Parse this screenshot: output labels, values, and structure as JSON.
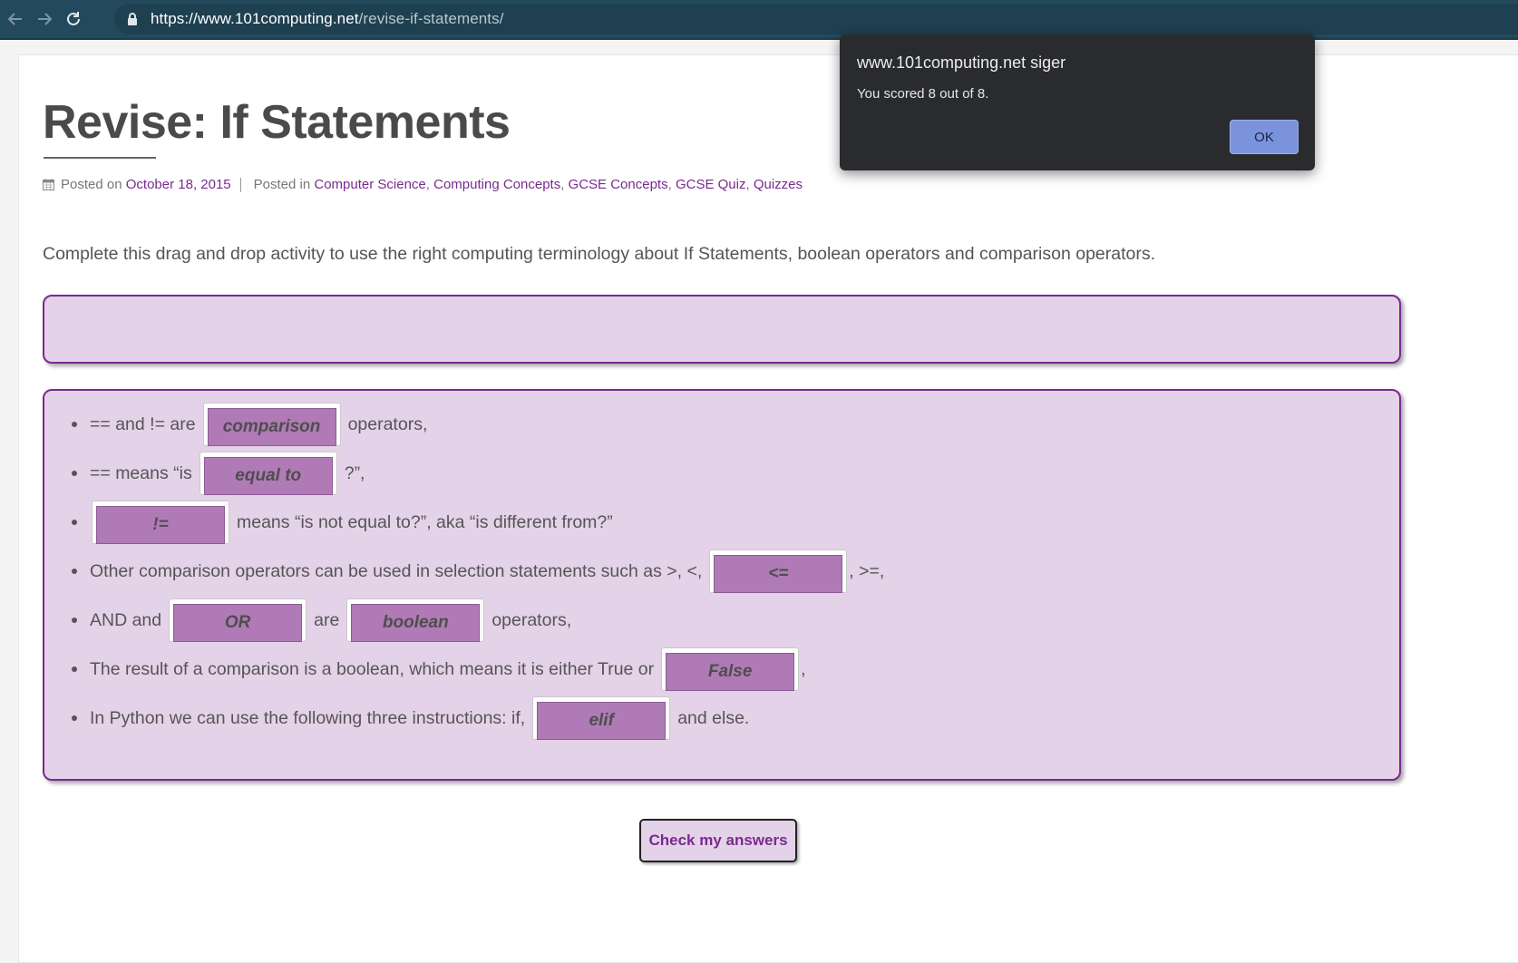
{
  "browser": {
    "url_host": "https://www.101computing.net",
    "url_path": "/revise-if-statements/"
  },
  "page": {
    "title": "Revise: If Statements",
    "meta": {
      "posted_on_label": "Posted on",
      "date": "October 18, 2015",
      "posted_in_label": "Posted in",
      "categories": [
        "Computer Science",
        "Computing Concepts",
        "GCSE Concepts",
        "GCSE Quiz",
        "Quizzes"
      ]
    },
    "intro": "Complete this drag and drop activity to use the right computing terminology about If Statements, boolean operators and comparison operators.",
    "quiz": {
      "items": [
        {
          "before": "== and != are",
          "answer": "comparison",
          "after": "operators,"
        },
        {
          "before": "== means “is",
          "answer": "equal to",
          "after": "?”,"
        },
        {
          "before": "",
          "answer": "!=",
          "after": "means “is not equal to?”, aka “is different from?”"
        },
        {
          "before": "Other comparison operators can be used in selection statements such as >, <,",
          "answer": "<=",
          "after": ", >=,"
        },
        {
          "before": "AND and",
          "answer": "OR",
          "middle": "are",
          "answer2": "boolean",
          "after": "operators,"
        },
        {
          "before": "The result of a comparison is a boolean, which means it is either True or",
          "answer": "False",
          "after": ","
        },
        {
          "before": "In Python we can use the following three instructions: if,",
          "answer": "elif",
          "after": "and else."
        }
      ]
    },
    "check_button": "Check my answers"
  },
  "dialog": {
    "origin": "www.101computing.net siger",
    "message": "You scored 8 out of 8.",
    "ok_label": "OK"
  }
}
